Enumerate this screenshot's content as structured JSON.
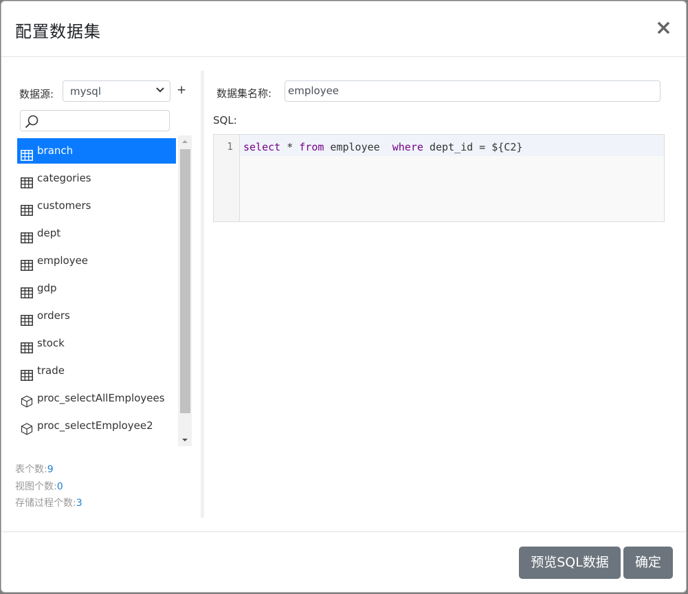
{
  "dialog": {
    "title": "配置数据集",
    "close_glyph": "×"
  },
  "datasource": {
    "label": "数据源:",
    "selected": "mysql",
    "add_glyph": "+"
  },
  "search": {
    "placeholder": ""
  },
  "tables": [
    {
      "name": "branch",
      "type": "table",
      "icon": "table-icon",
      "selected": true
    },
    {
      "name": "categories",
      "type": "table",
      "icon": "table-icon"
    },
    {
      "name": "customers",
      "type": "table",
      "icon": "table-icon"
    },
    {
      "name": "dept",
      "type": "table",
      "icon": "table-icon"
    },
    {
      "name": "employee",
      "type": "table",
      "icon": "table-icon"
    },
    {
      "name": "gdp",
      "type": "table",
      "icon": "table-icon"
    },
    {
      "name": "orders",
      "type": "table",
      "icon": "table-icon"
    },
    {
      "name": "stock",
      "type": "table",
      "icon": "table-icon"
    },
    {
      "name": "trade",
      "type": "table",
      "icon": "table-icon"
    },
    {
      "name": "proc_selectAllEmployees",
      "type": "procedure",
      "icon": "cube-icon"
    },
    {
      "name": "proc_selectEmployee2",
      "type": "procedure",
      "icon": "cube-icon"
    }
  ],
  "stats": {
    "tables_label": "表个数:",
    "tables_count": "9",
    "views_label": "视图个数:",
    "views_count": "0",
    "procs_label": "存储过程个数:",
    "procs_count": "3"
  },
  "dataset": {
    "name_label": "数据集名称:",
    "name_value": "employee",
    "sql_label": "SQL:",
    "line_number": "1",
    "sql_tokens": [
      {
        "t": "select",
        "k": "kw"
      },
      {
        "t": " * ",
        "k": "tx"
      },
      {
        "t": "from",
        "k": "kw"
      },
      {
        "t": " employee  ",
        "k": "tx"
      },
      {
        "t": "where",
        "k": "kw"
      },
      {
        "t": " dept_id = ${C2}",
        "k": "tx"
      }
    ]
  },
  "footer": {
    "preview_label": "预览SQL数据",
    "ok_label": "确定"
  },
  "colors": {
    "accent": "#0a7bff",
    "button": "#6c757d",
    "keyword": "#770088",
    "count": "#1f7fd1"
  }
}
